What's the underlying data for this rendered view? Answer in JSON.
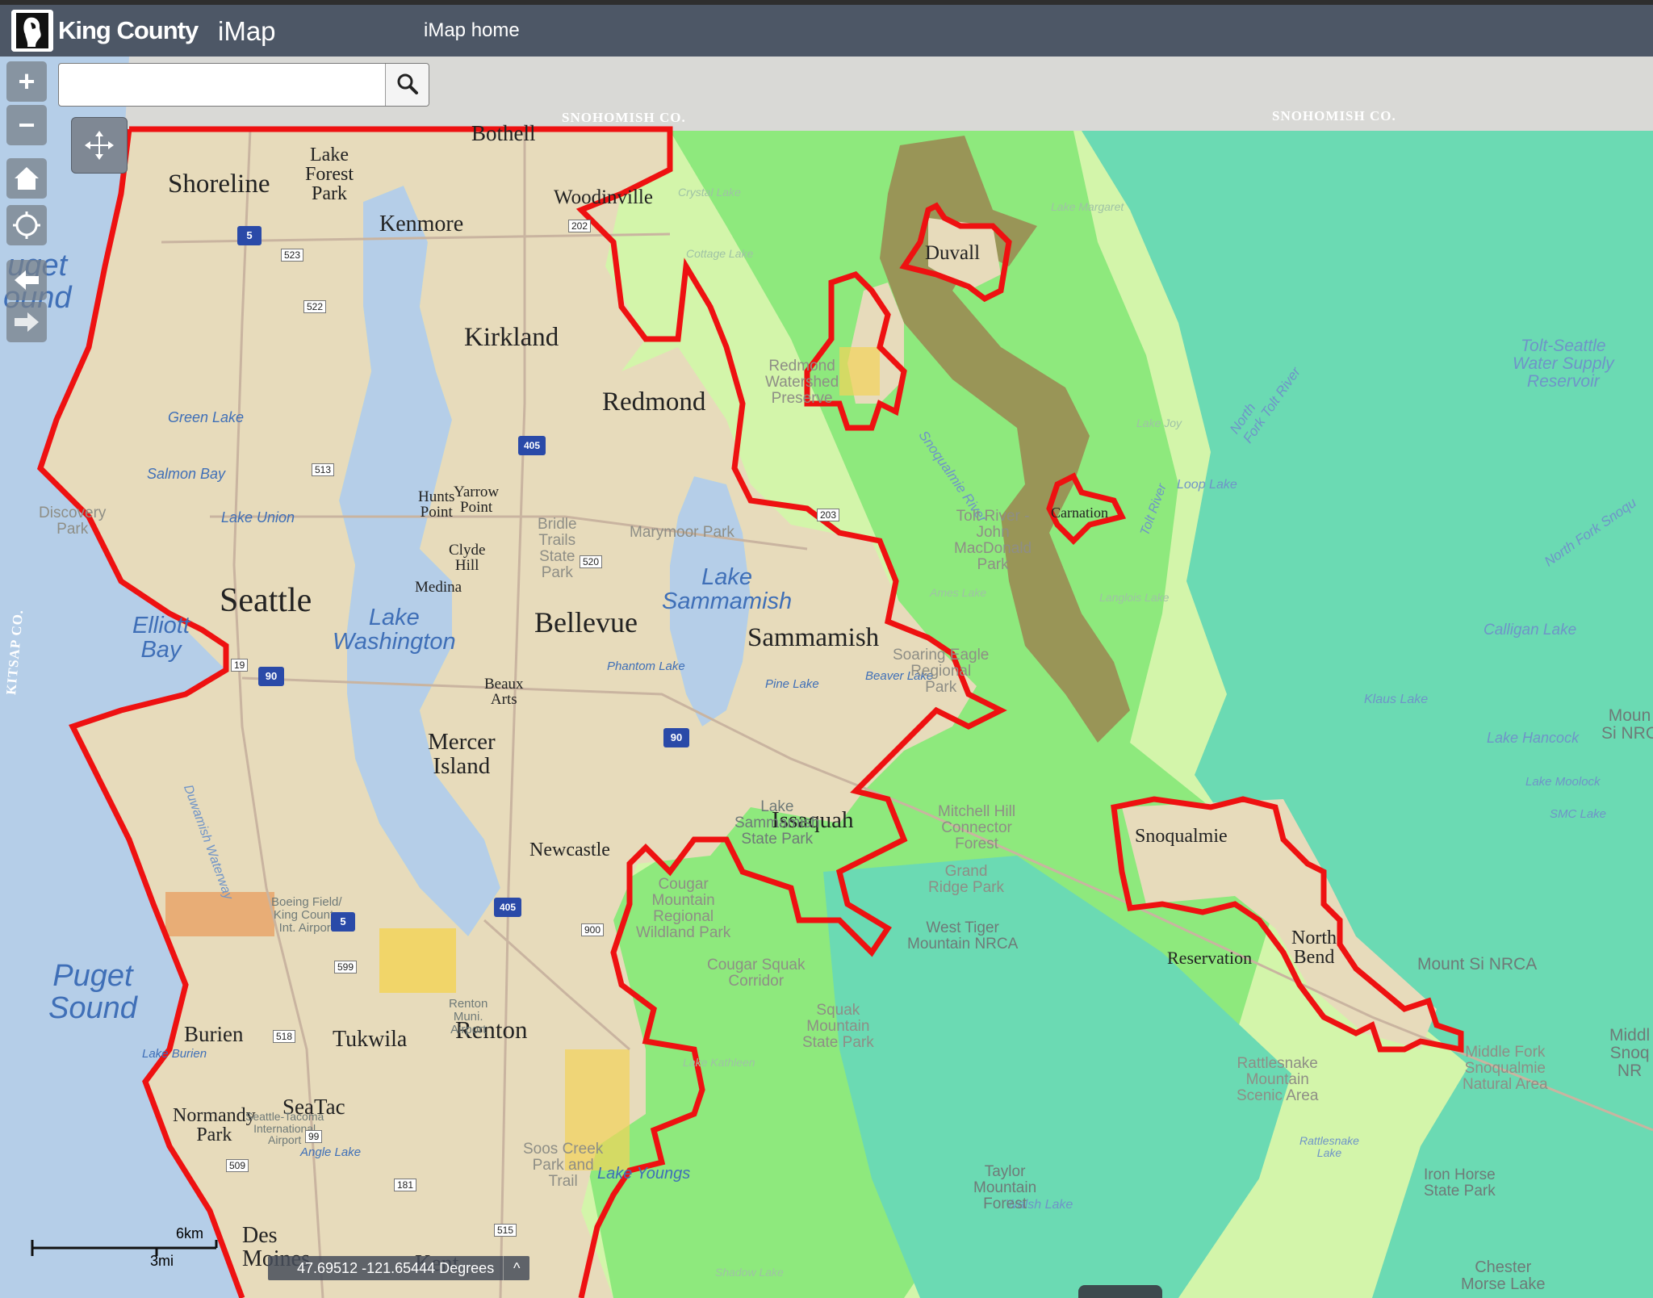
{
  "header": {
    "brand": "King County",
    "app_title": "iMap",
    "home_link": "iMap home"
  },
  "search": {
    "value": "",
    "placeholder": ""
  },
  "map_tools": {
    "zoom_in": "+",
    "zoom_out": "−",
    "home": "home-icon",
    "locate": "crosshair-icon",
    "back": "arrow-left-icon",
    "forward": "arrow-right-icon",
    "pan": "move-icon"
  },
  "county_labels": {
    "snohomish_west": "SNOHOMISH CO.",
    "snohomish_east": "SNOHOMISH CO.",
    "kitsap": "KITSAP CO."
  },
  "cities": {
    "shoreline": "Shoreline",
    "lake_forest_park": "Lake\nForest\nPark",
    "bothell": "Bothell",
    "woodinville": "Woodinville",
    "kenmore": "Kenmore",
    "kirkland": "Kirkland",
    "redmond": "Redmond",
    "duvall": "Duvall",
    "carnation": "Carnation",
    "seattle": "Seattle",
    "bellevue": "Bellevue",
    "sammamish": "Sammamish",
    "hunts_point": "Hunts\nPoint",
    "yarrow_point": "Yarrow\nPoint",
    "clyde_hill": "Clyde\nHill",
    "medina": "Medina",
    "beaux_arts": "Beaux\nArts",
    "mercer_island": "Mercer\nIsland",
    "newcastle": "Newcastle",
    "issaquah": "Issaquah",
    "snoqualmie": "Snoqualmie",
    "north_bend": "North\nBend",
    "renton": "Renton",
    "tukwila": "Tukwila",
    "burien": "Burien",
    "seatac": "SeaTac",
    "normandy_park": "Normandy\nPark",
    "des_moines": "Des\nMoines",
    "kent": "Kent"
  },
  "water": {
    "puget_sound_top": "uget\nound",
    "puget_sound": "Puget\nSound",
    "elliott_bay": "Elliott\nBay",
    "lake_washington": "Lake\nWashington",
    "lake_sammamish": "Lake\nSammamish",
    "green_lake": "Green Lake",
    "salmon_bay": "Salmon Bay",
    "lake_union": "Lake Union",
    "phantom_lake": "Phantom Lake",
    "pine_lake": "Pine Lake",
    "beaver_lake": "Beaver Lake",
    "lake_burien": "Lake Burien",
    "angle_lake": "Angle Lake",
    "lake_youngs": "Lake Youngs",
    "calligan_lake": "Calligan Lake",
    "lake_hancock": "Lake Hancock",
    "tolt_reservoir": "Tolt-Seattle\nWater Supply\nReservoir",
    "loop_lake": "Loop Lake",
    "klaus_lake": "Klaus Lake",
    "lake_moolock": "Lake Moolock",
    "smc_lake": "SMC Lake",
    "walsh_lake": "Walsh Lake",
    "rattlesnake_lake": "Rattlesnake\nLake",
    "chester_morse_lake": "Chester\nMorse Lake",
    "snoqualmie_river": "Snoqualmie River",
    "north_fork_tolt": "North\nFork Tolt River",
    "tolt_river": "Tolt River",
    "north_fork_snoqualmie": "North Fork Snoqu",
    "duwamish": "Duwamish Waterway",
    "reservation": "Reservation"
  },
  "parks": {
    "discovery_park": "Discovery\nPark",
    "bridle_trails": "Bridle\nTrails\nState\nPark",
    "marymoor": "Marymoor Park",
    "redmond_watershed": "Redmond\nWatershed\nPreserve",
    "tolt_macdonald": "Tolt River -\nJohn\nMacDonald\nPark",
    "soaring_eagle": "Soaring Eagle\nRegional\nPark",
    "lake_sammamish_sp": "Lake\nSammamish\nState Park",
    "mitchell_hill": "Mitchell Hill\nConnector\nForest",
    "grand_ridge": "Grand\nRidge Park",
    "cougar_mountain": "Cougar\nMountain\nRegional\nWildland Park",
    "cougar_squak": "Cougar Squak\nCorridor",
    "squak_mountain": "Squak\nMountain\nState Park",
    "west_tiger": "West Tiger\nMountain NRCA",
    "mount_si": "Mount Si NRCA",
    "rattlesnake_mountain": "Rattlesnake\nMountain\nScenic Area",
    "middle_fork": "Middle Fork\nSnoqualmie\nNatural Area",
    "iron_horse": "Iron Horse\nState Park",
    "taylor_mountain": "Taylor\nMountain\nForest",
    "soos_creek": "Soos Creek\nPark and\nTrail",
    "boeing_field": "Boeing Field/\nKing County\nInt. Airport",
    "renton_airport": "Renton\nMuni.\nAirport",
    "seatac_airport": "Seattle-Tacoma\nInternational\nAirport",
    "lake_margaret": "Lake Margaret",
    "cottage_lake": "Cottage Lake",
    "crystal_lake": "Crystal Lake",
    "lake_joy": "Lake Joy",
    "ames_lake": "Ames Lake",
    "langlois_lake": "Langlois Lake",
    "lake_kathleen": "Lake Kathleen",
    "shadow_lake": "Shadow Lake",
    "mount_si_nrca_edge": "Moun\nSi NRC",
    "middle_snoq_edge": "Middl\nSnoq\nNR"
  },
  "highway_shields": {
    "i5_north": "5",
    "i5_south": "5",
    "i405_north": "405",
    "i405_south": "405",
    "i90_west": "90",
    "i90_east": "90",
    "sr523": "523",
    "sr522": "522",
    "sr513": "513",
    "sr520": "520",
    "sr900": "900",
    "sr599": "599",
    "sr518": "518",
    "sr509": "509",
    "sr181": "181",
    "sr99": "99",
    "sr515": "515",
    "sr202": "202",
    "sr203": "203",
    "sr19": "19"
  },
  "coordinates": "47.69512 -121.65444 Degrees",
  "scale": {
    "metric": "6km",
    "imperial": "3mi"
  },
  "colors": {
    "header": "#4d5766",
    "water": "#b7cfe9",
    "urban": "#e6d9b8",
    "rural_light": "#d2f5a8",
    "rural_mid": "#8fe87c",
    "forest": "#6bd9b2",
    "floodplain": "#968e52",
    "ugb_outline": "#ee1111"
  }
}
